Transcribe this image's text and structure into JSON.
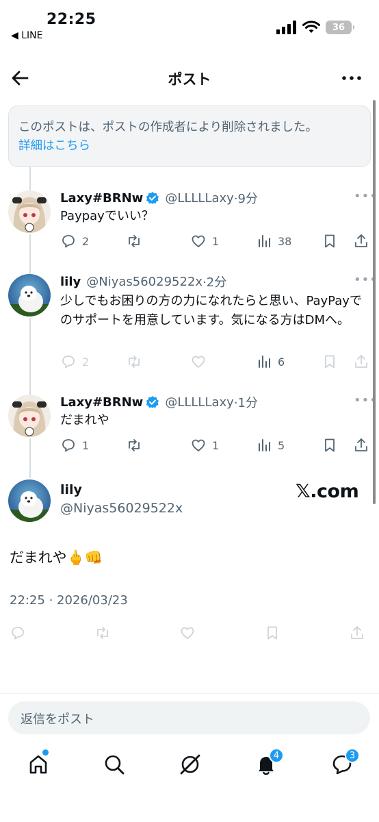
{
  "status_bar": {
    "time": "22:25",
    "back_app": "◀ LINE",
    "battery": "36"
  },
  "header": {
    "title": "ポスト"
  },
  "deleted_notice": {
    "text": "このポストは、ポストの作成者により削除されました。",
    "link": "詳細はこちら"
  },
  "replies": [
    {
      "name": "Laxy#BRNw",
      "handle": "@LLLLLaxy",
      "time": "·9分",
      "text": "Paypayでいい？",
      "comments": "2",
      "retweets": "",
      "likes": "1",
      "views": "38",
      "dimmed": false
    },
    {
      "name": "lily",
      "handle": "@Niyas56029522x",
      "time": "·2分",
      "text": "少しでもお困りの方の力になれたらと思い、PayPayでのサポートを用意しています。気になる方はDMへ。",
      "comments": "2",
      "retweets": "",
      "likes": "",
      "views": "6",
      "dimmed": true
    },
    {
      "name": "Laxy#BRNw",
      "handle": "@LLLLLaxy",
      "time": "·1分",
      "text": "だまれや",
      "comments": "1",
      "retweets": "",
      "likes": "1",
      "views": "5",
      "dimmed": false
    }
  ],
  "main_post": {
    "name": "lily",
    "handle": "@Niyas56029522x",
    "watermark": "𝕏.com",
    "text": "だまれや🖕👊",
    "meta": "22:25 · 2026/03/23"
  },
  "reply_bar": {
    "placeholder": "返信をポスト"
  },
  "tab_bar": {
    "notifications_badge": "4",
    "messages_badge": "3"
  },
  "colors": {
    "accent": "#1d9bf0",
    "text": "#0f1419",
    "secondary": "#536471"
  }
}
